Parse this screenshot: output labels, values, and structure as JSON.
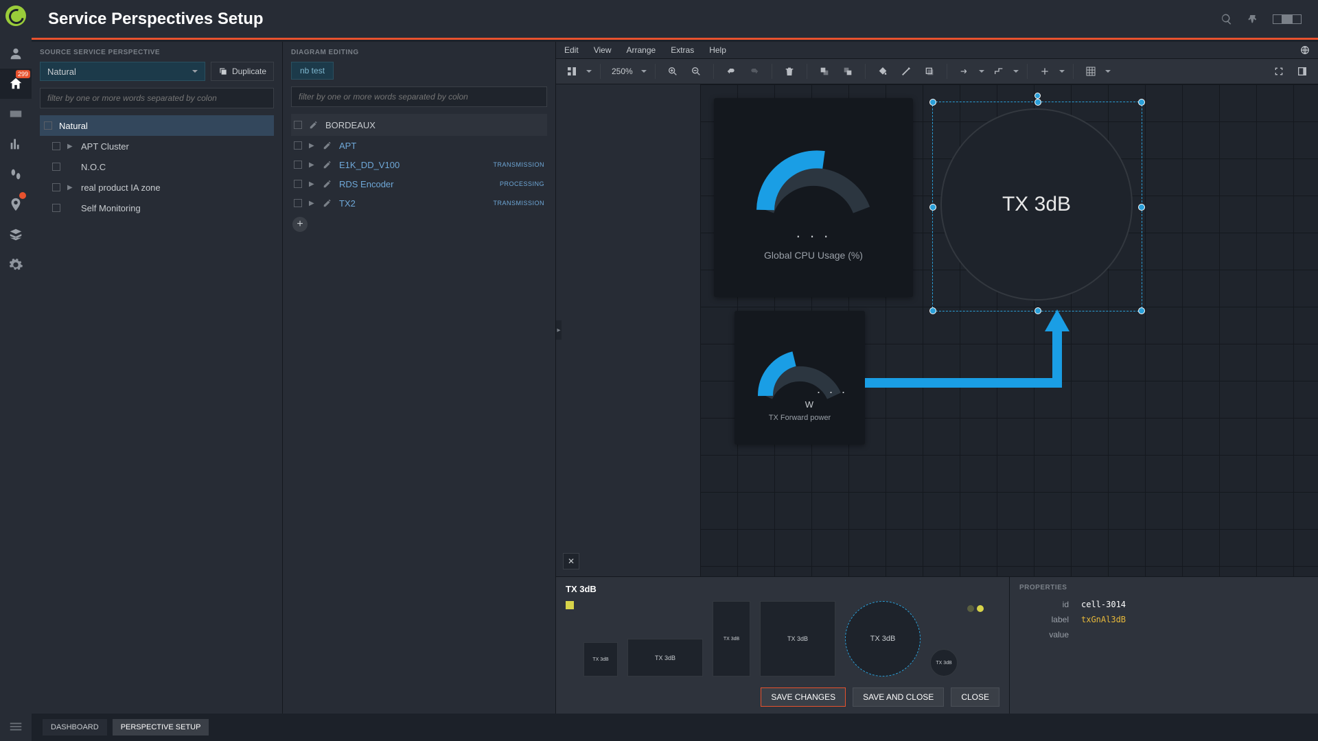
{
  "header": {
    "title": "Service Perspectives Setup"
  },
  "gnav": {
    "home_badge": "299"
  },
  "source_panel": {
    "title": "SOURCE SERVICE PERSPECTIVE",
    "selected": "Natural",
    "duplicate_label": "Duplicate",
    "filter_placeholder": "filter by one or more words separated by colon",
    "items": [
      {
        "label": "Natural",
        "selected": true,
        "expandable": false
      },
      {
        "label": "APT Cluster",
        "expandable": true
      },
      {
        "label": "N.O.C",
        "expandable": false
      },
      {
        "label": "real product IA zone",
        "expandable": true
      },
      {
        "label": "Self Monitoring",
        "expandable": false
      }
    ]
  },
  "diagram_panel": {
    "title": "DIAGRAM EDITING",
    "tabs": [
      {
        "label": "nb test"
      }
    ],
    "filter_placeholder": "filter by one or more words separated by colon",
    "header_item": "BORDEAUX",
    "items": [
      {
        "label": "APT",
        "tag": ""
      },
      {
        "label": "E1K_DD_V100",
        "tag": "TRANSMISSION"
      },
      {
        "label": "RDS Encoder",
        "tag": "PROCESSING"
      },
      {
        "label": "TX2",
        "tag": "TRANSMISSION"
      }
    ]
  },
  "menubar": {
    "items": [
      "Edit",
      "View",
      "Arrange",
      "Extras",
      "Help"
    ]
  },
  "toolbar": {
    "zoom": "250%"
  },
  "canvas": {
    "cpu_widget": {
      "title": "Global CPU Usage (%)",
      "value": ". . ."
    },
    "tx_widget": {
      "title": "TX Forward power",
      "unit": "W",
      "value": ". . ."
    },
    "tx_circle": {
      "label": "TX 3dB"
    }
  },
  "bottom": {
    "selected_label": "TX 3dB",
    "shape_labels": [
      "TX 3dB",
      "TX 3dB",
      "TX 3dB",
      "TX 3dB",
      "TX 3dB",
      "TX 3dB"
    ],
    "buttons": {
      "save": "SAVE CHANGES",
      "save_close": "SAVE AND CLOSE",
      "close": "CLOSE"
    },
    "properties_title": "PROPERTIES",
    "props": {
      "id": "cell-3014",
      "label": "txGnAl3dB",
      "value": ""
    },
    "prop_keys": {
      "id": "id",
      "label": "label",
      "value": "value"
    }
  },
  "bottom_tabs": {
    "dashboard": "DASHBOARD",
    "perspective": "PERSPECTIVE SETUP"
  }
}
